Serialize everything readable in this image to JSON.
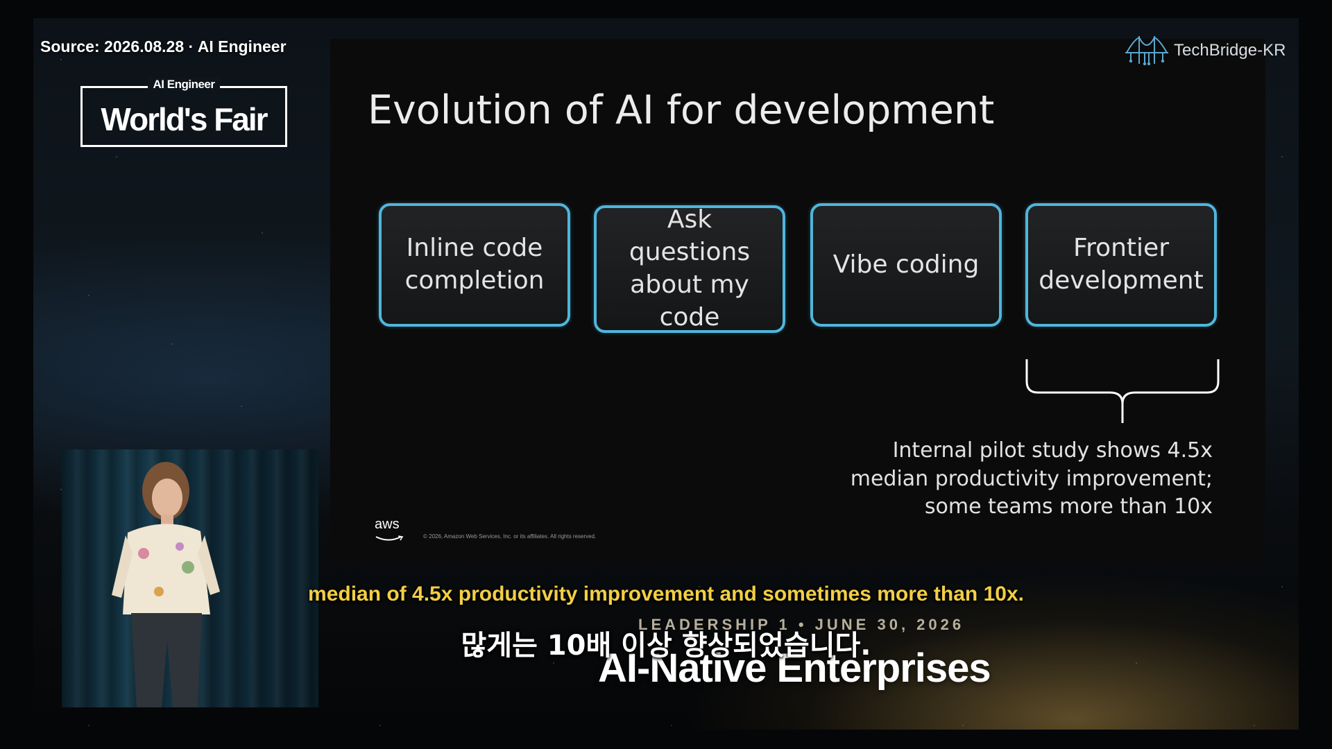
{
  "source_text": "Source: 2026.08.28 · AI Engineer",
  "event_logo": {
    "small": "AI Engineer",
    "big": "World's Fair"
  },
  "channel": {
    "name": "TechBridge-KR",
    "icon": "bridge-icon"
  },
  "slide": {
    "title": "Evolution of AI for development",
    "cards": [
      {
        "label": "Inline code completion"
      },
      {
        "label": "Ask questions about my code"
      },
      {
        "label": "Vibe coding"
      },
      {
        "label": "Frontier development"
      }
    ],
    "pilot_note": "Internal pilot study shows 4.5x median productivity improvement; some teams more than 10x",
    "aws_logo": "aws",
    "copyright": "© 2026, Amazon Web Services, Inc. or its affiliates. All rights reserved.",
    "accent_color": "#4fb6dc"
  },
  "event": {
    "line": "LEADERSHIP 1 • JUNE 30, 2026",
    "title": "AI-Native Enterprises"
  },
  "subtitles": {
    "english": "median of 4.5x productivity improvement and sometimes more than 10x.",
    "korean": "많게는 10배 이상 향상되었습니다.",
    "english_color": "#f2cf44"
  }
}
